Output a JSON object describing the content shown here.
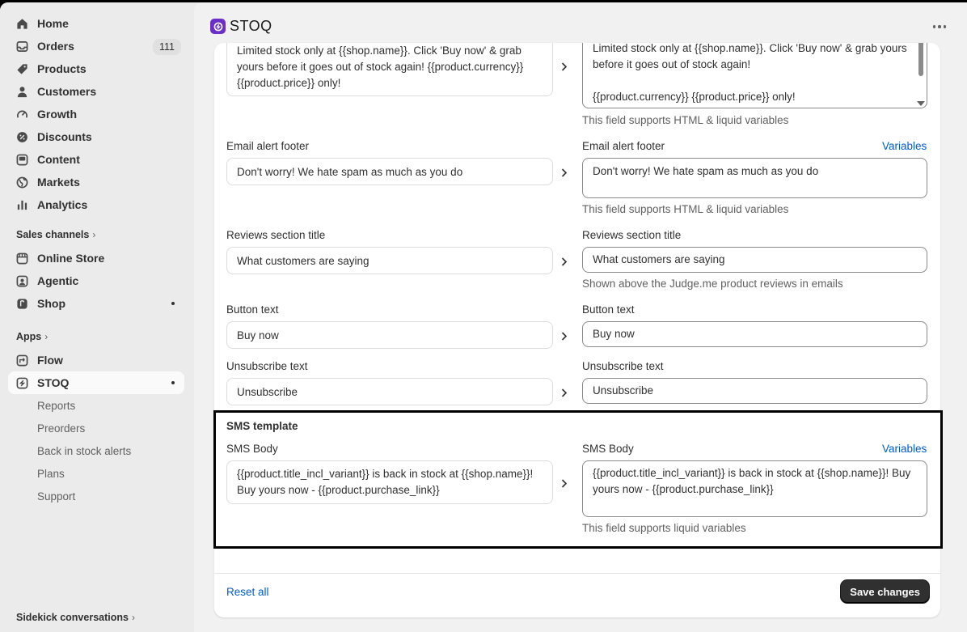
{
  "sidebar": {
    "nav": [
      {
        "label": "Home",
        "icon": "home-icon"
      },
      {
        "label": "Orders",
        "icon": "inbox-icon",
        "badge": "111"
      },
      {
        "label": "Products",
        "icon": "tag-icon"
      },
      {
        "label": "Customers",
        "icon": "person-icon"
      },
      {
        "label": "Growth",
        "icon": "growth-icon"
      },
      {
        "label": "Discounts",
        "icon": "discount-icon"
      },
      {
        "label": "Content",
        "icon": "content-icon"
      },
      {
        "label": "Markets",
        "icon": "globe-icon"
      },
      {
        "label": "Analytics",
        "icon": "bar-chart-icon"
      }
    ],
    "sales_channels_label": "Sales channels",
    "channels": [
      {
        "label": "Online Store",
        "icon": "store-icon"
      },
      {
        "label": "Agentic",
        "icon": "agentic-icon"
      },
      {
        "label": "Shop",
        "icon": "shop-icon"
      }
    ],
    "apps_label": "Apps",
    "apps": [
      {
        "label": "Flow",
        "icon": "flow-icon"
      },
      {
        "label": "STOQ",
        "icon": "stoq-icon"
      }
    ],
    "stoq_sub": [
      "Reports",
      "Preorders",
      "Back in stock alerts",
      "Plans",
      "Support"
    ],
    "sidekick_label": "Sidekick conversations"
  },
  "header": {
    "title": "STOQ"
  },
  "form": {
    "top_left_text": "Limited stock only at {{shop.name}}. Click 'Buy now' & grab yours before it goes out of stock again! {{product.currency}} {{product.price}} only!",
    "top_right_text": "Limited stock only at {{shop.name}}. Click 'Buy now' & grab yours before it goes out of stock again!\n\n{{product.currency}} {{product.price}} only!",
    "html_help": "This field supports HTML & liquid variables",
    "variables_label": "Variables",
    "footer_label": "Email alert footer",
    "footer_value": "Don't worry! We hate spam as much as you do",
    "reviews_label": "Reviews section title",
    "reviews_value": "What customers are saying",
    "reviews_help": "Shown above the Judge.me product reviews in emails",
    "button_label": "Button text",
    "button_value": "Buy now",
    "unsub_label": "Unsubscribe text",
    "unsub_value": "Unsubscribe",
    "sms_title": "SMS template",
    "sms_label": "SMS Body",
    "sms_value": "{{product.title_incl_variant}} is back in stock at {{shop.name}}! Buy yours now - {{product.purchase_link}}",
    "sms_help": "This field supports liquid variables"
  },
  "footer": {
    "reset_label": "Reset all",
    "save_label": "Save changes"
  },
  "colors": {
    "accent": "#005bd3",
    "app_logo": "#6c2ec8",
    "primary_button": "#303030"
  }
}
